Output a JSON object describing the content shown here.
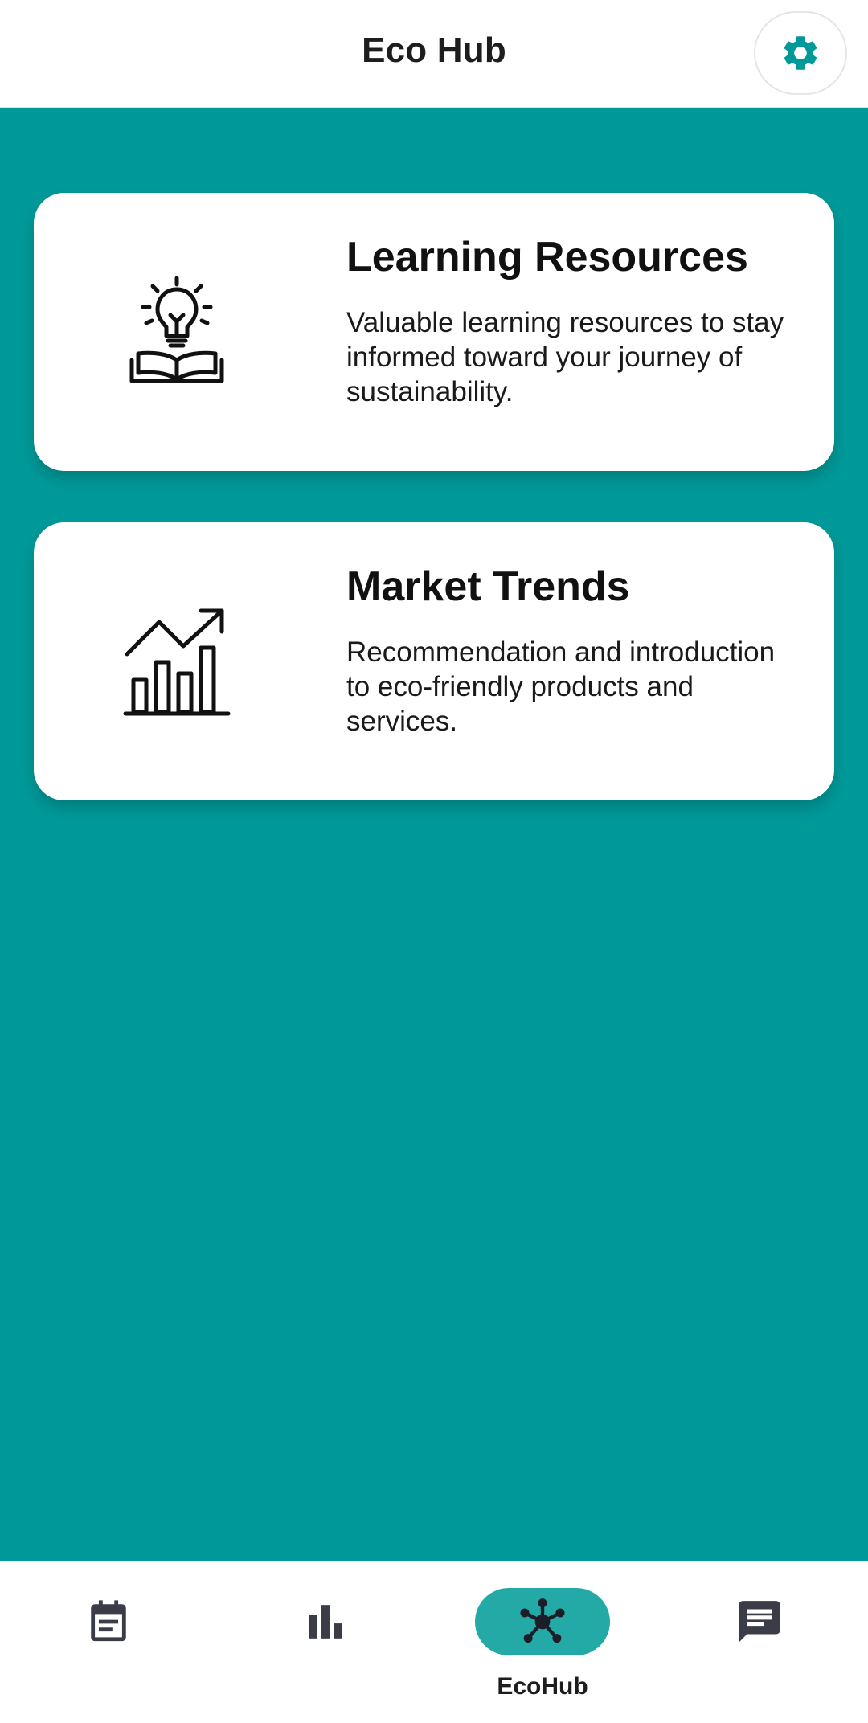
{
  "app_bar": {
    "title": "Eco Hub",
    "settings_icon": "gear-icon"
  },
  "colors": {
    "accent": "#009999",
    "active_nav_pill": "#23aaa6",
    "card_background": "#ffffff"
  },
  "cards": [
    {
      "title": "Learning Resources",
      "description": "Valuable learning resources to stay informed toward your journey of sustainability.",
      "icon": "lightbulb-book-icon"
    },
    {
      "title": "Market Trends",
      "description": "Recommendation and introduction to eco-friendly products and services.",
      "icon": "growth-chart-icon"
    }
  ],
  "bottom_nav": {
    "items": [
      {
        "icon": "calendar-icon",
        "label": "",
        "active": false
      },
      {
        "icon": "bar-chart-icon",
        "label": "",
        "active": false
      },
      {
        "icon": "network-hub-icon",
        "label": "EcoHub",
        "active": true
      },
      {
        "icon": "chat-icon",
        "label": "",
        "active": false
      }
    ]
  }
}
